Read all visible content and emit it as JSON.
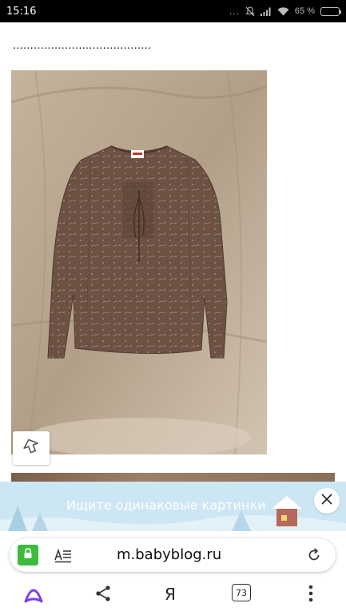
{
  "status_bar": {
    "time": "15:16",
    "dots": "...",
    "battery_percent": "65 %",
    "battery_level": 0.65
  },
  "content": {
    "dotted_text": "........................................"
  },
  "banner": {
    "text": "Ищите одинаковые картинки",
    "background_color": "#cde6f3"
  },
  "url_bar": {
    "url": "m.babyblog.ru",
    "secure_color": "#3dbb3d"
  },
  "bottom_nav": {
    "yandex_letter": "Я",
    "tab_count": "73",
    "alice_color": "#7b3ff2"
  },
  "icons": [
    "mute-bell-icon",
    "signal-icon",
    "wifi-icon",
    "battery-icon",
    "lock-icon",
    "reader-mode-icon",
    "reload-icon",
    "close-icon",
    "alice-icon",
    "share-icon",
    "menu-dots-icon",
    "tracking-arrow-icon"
  ]
}
